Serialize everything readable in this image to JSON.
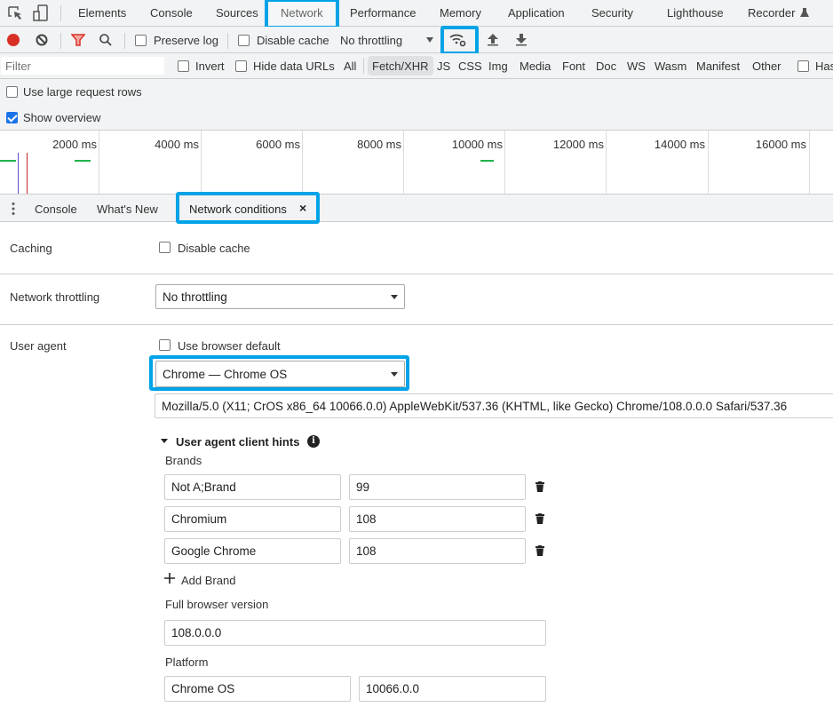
{
  "main_tabs": [
    "Elements",
    "Console",
    "Sources",
    "Network",
    "Performance",
    "Memory",
    "Application",
    "Security",
    "Lighthouse",
    "Recorder"
  ],
  "active_main_tab": "Network",
  "toolbar": {
    "preserve_log": "Preserve log",
    "preserve_log_checked": false,
    "disable_cache": "Disable cache",
    "disable_cache_checked": false,
    "throttling": "No throttling"
  },
  "filter": {
    "placeholder": "Filter",
    "invert": "Invert",
    "hide_data_urls": "Hide data URLs",
    "types": [
      "All",
      "Fetch/XHR",
      "JS",
      "CSS",
      "Img",
      "Media",
      "Font",
      "Doc",
      "WS",
      "Wasm",
      "Manifest",
      "Other"
    ],
    "active_type": "Fetch/XHR",
    "has_blocked": "Has"
  },
  "options": {
    "large_rows": "Use large request rows",
    "large_rows_checked": false,
    "show_overview": "Show overview",
    "show_overview_checked": true
  },
  "overview": {
    "ticks": [
      "2000 ms",
      "4000 ms",
      "6000 ms",
      "8000 ms",
      "10000 ms",
      "12000 ms",
      "14000 ms",
      "16000 ms"
    ]
  },
  "drawer": {
    "tabs": [
      "Console",
      "What's New",
      "Network conditions"
    ],
    "active": "Network conditions",
    "close": "×"
  },
  "conditions": {
    "caching_label": "Caching",
    "disable_cache": "Disable cache",
    "disable_cache_checked": false,
    "throttling_label": "Network throttling",
    "throttling_value": "No throttling",
    "ua_label": "User agent",
    "use_default": "Use browser default",
    "use_default_checked": false,
    "ua_select": "Chrome — Chrome OS",
    "ua_string": "Mozilla/5.0 (X11; CrOS x86_64 10066.0.0) AppleWebKit/537.36 (KHTML, like Gecko) Chrome/108.0.0.0 Safari/537.36",
    "hints_title": "User agent client hints",
    "brands_label": "Brands",
    "brands": [
      {
        "name": "Not A;Brand",
        "version": "99"
      },
      {
        "name": "Chromium",
        "version": "108"
      },
      {
        "name": "Google Chrome",
        "version": "108"
      }
    ],
    "add_brand": "Add Brand",
    "full_version_label": "Full browser version",
    "full_version": "108.0.0.0",
    "platform_label": "Platform",
    "platform": "Chrome OS",
    "platform_version": "10066.0.0"
  },
  "colors": {
    "highlight": "#00a3e8",
    "record": "#d93025",
    "filter_icon": "#d93025",
    "checkbox": "#1a73e8"
  }
}
